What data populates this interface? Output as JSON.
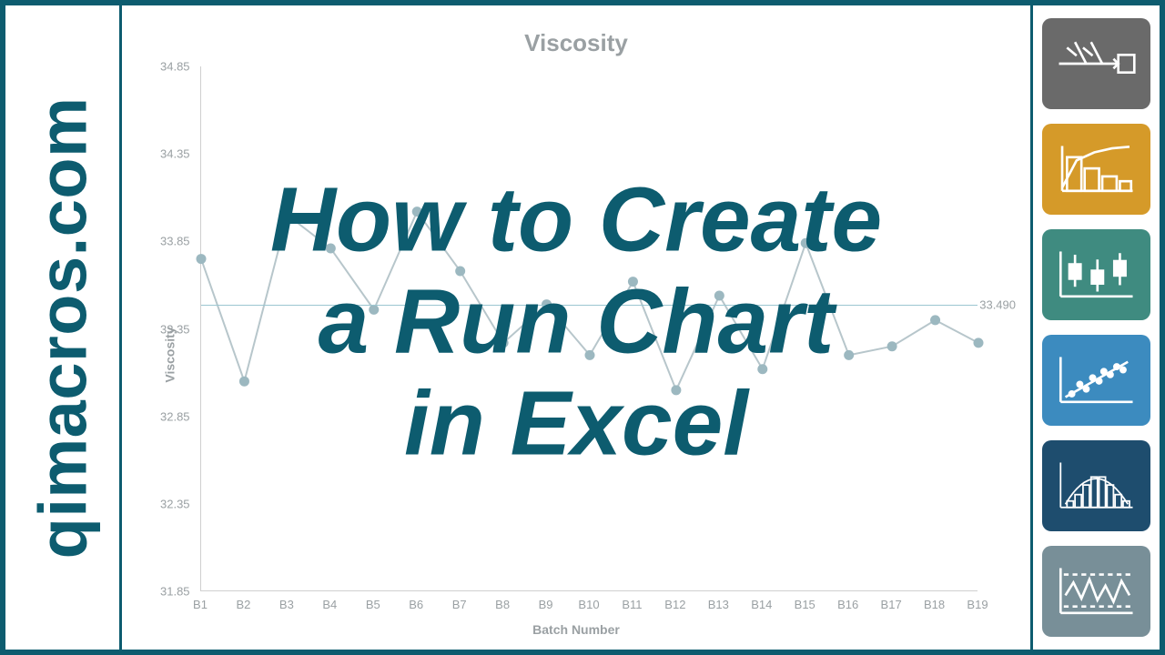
{
  "brand_text": "qimacros.com",
  "overlay": {
    "line1": "How to Create",
    "line2": "a Run Chart",
    "line3": "in Excel"
  },
  "colors": {
    "border": "#0d5c6f",
    "overlay_text": "#0d5c6f",
    "axis_text": "#9aa0a3",
    "series": "#9cb8c0",
    "median": "#9cc6d1"
  },
  "tiles": [
    {
      "name": "fishbone-icon",
      "bg": "#6a6a6a"
    },
    {
      "name": "pareto-icon",
      "bg": "#d59a29"
    },
    {
      "name": "boxplot-icon",
      "bg": "#3f8b80"
    },
    {
      "name": "scatter-icon",
      "bg": "#3c8bbf"
    },
    {
      "name": "histogram-icon",
      "bg": "#1e4d6e"
    },
    {
      "name": "controlchart-icon",
      "bg": "#788f98"
    }
  ],
  "chart_data": {
    "type": "line",
    "title": "Viscosity",
    "xlabel": "Batch Number",
    "ylabel": "Viscosity",
    "ylim": [
      31.85,
      34.85
    ],
    "yticks": [
      31.85,
      32.35,
      32.85,
      33.35,
      33.85,
      34.35,
      34.85
    ],
    "median": 33.49,
    "median_label": "33.490",
    "categories": [
      "B1",
      "B2",
      "B3",
      "B4",
      "B5",
      "B6",
      "B7",
      "B8",
      "B9",
      "B10",
      "B11",
      "B12",
      "B13",
      "B14",
      "B15",
      "B16",
      "B17",
      "B18",
      "B19"
    ],
    "values": [
      33.75,
      33.05,
      34.0,
      33.81,
      33.46,
      34.02,
      33.68,
      33.27,
      33.49,
      33.2,
      33.62,
      33.0,
      33.54,
      33.12,
      33.84,
      33.2,
      33.25,
      33.4,
      33.27
    ]
  }
}
